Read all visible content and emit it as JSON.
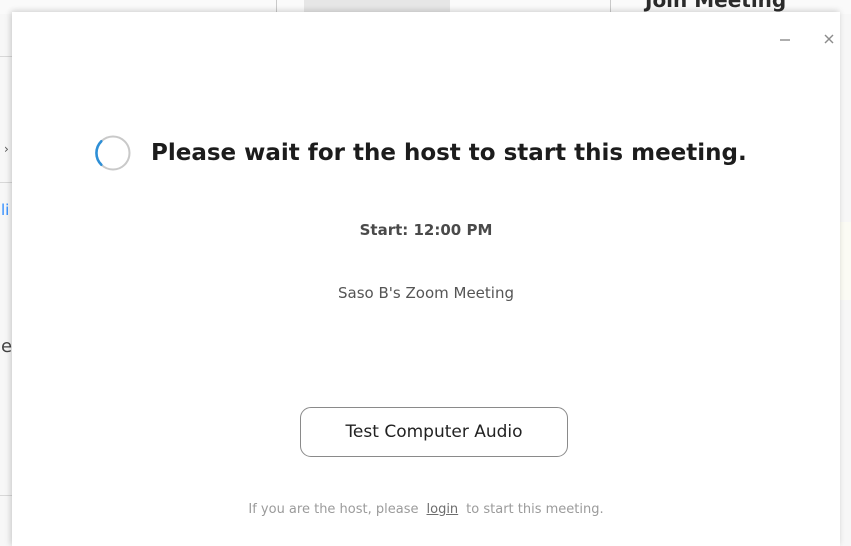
{
  "background": {
    "heading": "Join Meeting"
  },
  "dialog": {
    "status_title": "Please wait for the host to start this meeting.",
    "start_time": "Start: 12:00 PM",
    "meeting_name": "Saso B's Zoom Meeting",
    "test_audio_label": "Test Computer Audio",
    "footer": {
      "prefix": "If you are the host, please",
      "login_label": "login",
      "suffix": "to start this meeting."
    }
  },
  "icons": {
    "minimize": "minimize-icon",
    "close": "close-icon",
    "spinner": "loading-spinner-icon"
  },
  "colors": {
    "spinner_accent": "#2e8fd6",
    "spinner_track": "#c9c9c9",
    "title_text": "#1c1c1c",
    "secondary_text": "#555555",
    "footer_text": "#9b9b9b",
    "button_border": "#8a8a8a"
  }
}
